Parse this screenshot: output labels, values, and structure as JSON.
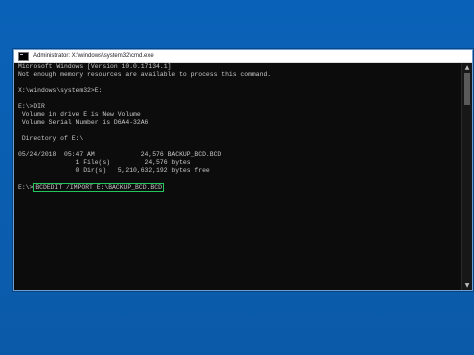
{
  "window": {
    "title": "Administrator: X:\\windows\\system32\\cmd.exe"
  },
  "console": {
    "lines": [
      "Microsoft Windows [Version 10.0.17134.1]",
      "Not enough memory resources are available to process this command.",
      "",
      "X:\\windows\\system32>E:",
      "",
      "E:\\>DIR",
      " Volume in drive E is New Volume",
      " Volume Serial Number is D6A4-32A6",
      "",
      " Directory of E:\\",
      "",
      "05/24/2018  05:47 AM            24,576 BACKUP_BCD.BCD",
      "               1 File(s)         24,576 bytes",
      "               0 Dir(s)   5,210,632,192 bytes free",
      ""
    ],
    "prompt": "E:\\>",
    "command": "BCDEDIT /IMPORT E:\\BACKUP_BCD.BCD"
  },
  "colors": {
    "desktop": "#0b5fb3",
    "console_bg": "#0c0c0c",
    "console_text": "#c8c8c8",
    "highlight": "#22c55e"
  }
}
